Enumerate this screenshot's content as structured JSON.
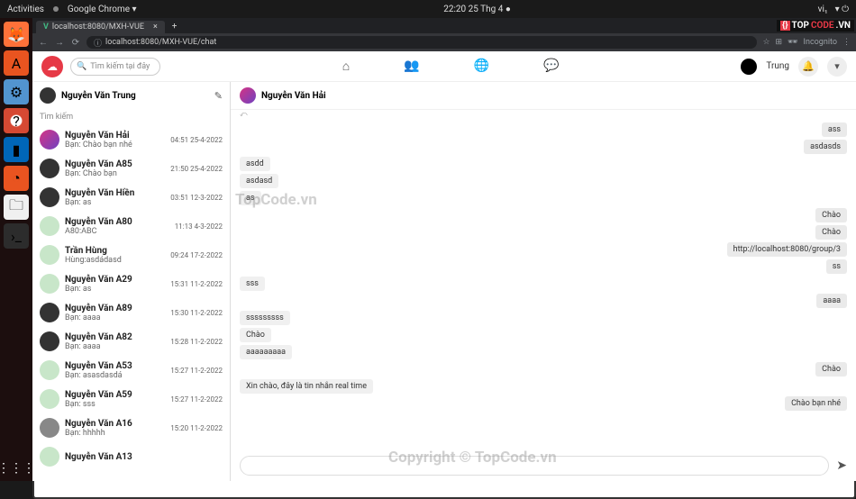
{
  "os": {
    "activities": "Activities",
    "app_indicator": "Google Chrome ▾",
    "clock": "22:20  25 Thg 4 ●",
    "lang": "vi₁"
  },
  "browser": {
    "tab_title": "localhost:8080/MXH-VUE",
    "url": "localhost:8080/MXH-VUE/chat",
    "incognito": "Incognito"
  },
  "app": {
    "search_placeholder": "Tìm kiếm tại đây",
    "username": "Trung"
  },
  "sidebar": {
    "me": "Nguyễn Văn Trung",
    "search": "Tìm kiếm",
    "items": [
      {
        "name": "Nguyễn Văn Hải",
        "preview": "Bạn: Chào bạn nhé",
        "time": "04:51 25-4-2022",
        "avatar": "pink"
      },
      {
        "name": "Nguyễn Văn A85",
        "preview": "Bạn: Chào bạn",
        "time": "21:50 25-4-2022",
        "avatar": "dark"
      },
      {
        "name": "Nguyễn Văn Hiền",
        "preview": "Bạn: as",
        "time": "03:51 12-3-2022",
        "avatar": "dark"
      },
      {
        "name": "Nguyễn Văn A80",
        "preview": "A80:ABC",
        "time": "11:13 4-3-2022",
        "avatar": "green"
      },
      {
        "name": "Trần Hùng",
        "preview": "Hùng:asdádasd",
        "time": "09:24 17-2-2022",
        "avatar": "green"
      },
      {
        "name": "Nguyễn Văn A29",
        "preview": "Bạn: as",
        "time": "15:31 11-2-2022",
        "avatar": "green"
      },
      {
        "name": "Nguyễn Văn A89",
        "preview": "Bạn: aaaa",
        "time": "15:30 11-2-2022",
        "avatar": "dark"
      },
      {
        "name": "Nguyễn Văn A82",
        "preview": "Bạn: aaaa",
        "time": "15:28 11-2-2022",
        "avatar": "dark"
      },
      {
        "name": "Nguyễn Văn A53",
        "preview": "Bạn: asasdasdá",
        "time": "15:27 11-2-2022",
        "avatar": "green"
      },
      {
        "name": "Nguyễn Văn A59",
        "preview": "Bạn: sss",
        "time": "15:27 11-2-2022",
        "avatar": "green"
      },
      {
        "name": "Nguyễn Văn A16",
        "preview": "Bạn: hhhhh",
        "time": "15:20 11-2-2022",
        "avatar": ""
      },
      {
        "name": "Nguyễn Văn A13",
        "preview": "",
        "time": "",
        "avatar": "green"
      }
    ]
  },
  "chat": {
    "partner": "Nguyễn Văn Hải",
    "meta": "⤺",
    "messages": [
      {
        "side": "right",
        "text": "ass"
      },
      {
        "side": "right",
        "text": "asdasds"
      },
      {
        "side": "left",
        "text": "asdd"
      },
      {
        "side": "left",
        "text": "asdasd"
      },
      {
        "side": "left",
        "text": "as"
      },
      {
        "side": "right",
        "text": "Chào"
      },
      {
        "side": "right",
        "text": "Chào"
      },
      {
        "side": "right",
        "text": "http://localhost:8080/group/3"
      },
      {
        "side": "right",
        "text": "ss"
      },
      {
        "side": "left",
        "text": "sss"
      },
      {
        "side": "right",
        "text": "aaaa"
      },
      {
        "side": "left",
        "text": "sssssssss"
      },
      {
        "side": "left",
        "text": "Chào"
      },
      {
        "side": "left",
        "text": "aaaaaaaaa"
      },
      {
        "side": "right",
        "text": "Chào"
      },
      {
        "side": "left",
        "text": "Xin chào, đây là tin nhắn real time"
      },
      {
        "side": "right",
        "text": "Chào bạn nhé"
      }
    ]
  },
  "watermark": {
    "w1": "TopCode.vn",
    "w2": "Copyright © TopCode.vn"
  },
  "badge": {
    "top": "TOP",
    "code": "CODE",
    "vn": ".VN"
  }
}
